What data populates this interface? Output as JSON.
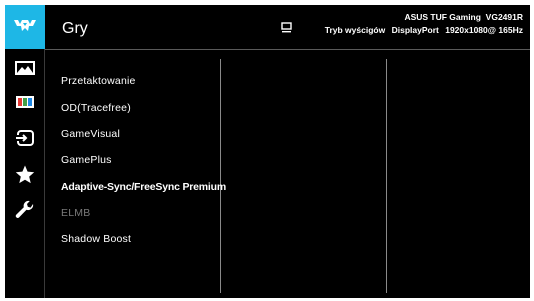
{
  "header": {
    "title": "Gry",
    "model": "ASUS TUF Gaming  VG2491R",
    "mode": "Tryb wyścigów",
    "input": "DisplayPort",
    "resolution": "1920x1080@ 165Hz"
  },
  "sidebar": {
    "items": [
      {
        "icon": "tuf-logo-icon"
      },
      {
        "icon": "image-icon"
      },
      {
        "icon": "color-icon"
      },
      {
        "icon": "input-select-icon"
      },
      {
        "icon": "star-icon"
      },
      {
        "icon": "wrench-icon"
      }
    ]
  },
  "menu": {
    "items": [
      {
        "label": "Przetaktowanie",
        "state": "normal"
      },
      {
        "label": "OD(Tracefree)",
        "state": "normal"
      },
      {
        "label": "GameVisual",
        "state": "normal"
      },
      {
        "label": "GamePlus",
        "state": "normal"
      },
      {
        "label": "Adaptive-Sync/FreeSync Premium",
        "state": "selected"
      },
      {
        "label": "ELMB",
        "state": "disabled"
      },
      {
        "label": "Shadow Boost",
        "state": "normal"
      }
    ]
  },
  "colors": {
    "background": "#000000",
    "accent": "#1eb7e6",
    "text": "#ffffff",
    "disabled_text": "#7a7a7a"
  }
}
